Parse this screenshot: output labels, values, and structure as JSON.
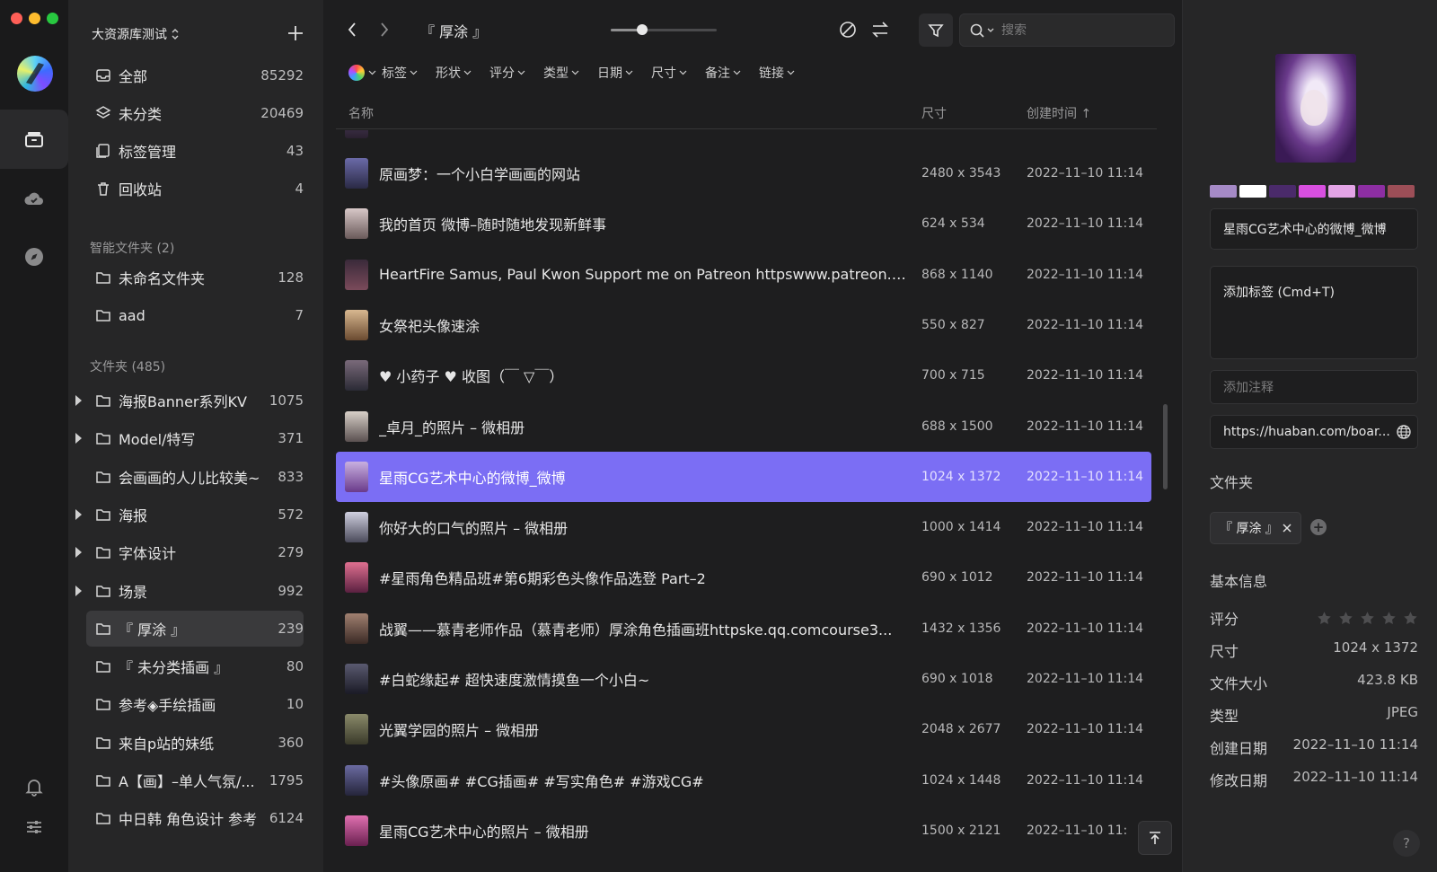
{
  "colors": {
    "accent": "#7b6ef4",
    "close": "#fe5f57",
    "minimize": "#febc2e",
    "zoom": "#28c840"
  },
  "rail": {
    "icons": [
      "app-logo",
      "library-icon",
      "cloud-icon",
      "compass-icon",
      "bell-icon",
      "sliders-icon"
    ]
  },
  "sidebar": {
    "library_name": "大资源库测试",
    "top_items": [
      {
        "icon": "inbox-icon",
        "label": "全部",
        "count": "85292"
      },
      {
        "icon": "layers-icon",
        "label": "未分类",
        "count": "20469"
      },
      {
        "icon": "tags-icon",
        "label": "标签管理",
        "count": "43"
      },
      {
        "icon": "trash-icon",
        "label": "回收站",
        "count": "4"
      }
    ],
    "smart_title": "智能文件夹 (2)",
    "smart_items": [
      {
        "label": "未命名文件夹",
        "count": "128"
      },
      {
        "label": "aad",
        "count": "7"
      }
    ],
    "folders_title": "文件夹 (485)",
    "folders": [
      {
        "label": "海报Banner系列KV",
        "count": "1075",
        "expandable": true
      },
      {
        "label": "Model/特写",
        "count": "371",
        "expandable": true
      },
      {
        "label": "会画画的人儿比较美~",
        "count": "833",
        "expandable": false
      },
      {
        "label": "海报",
        "count": "572",
        "expandable": true
      },
      {
        "label": "字体设计",
        "count": "279",
        "expandable": true
      },
      {
        "label": "场景",
        "count": "992",
        "expandable": true
      },
      {
        "label": "『 厚涂 』",
        "count": "239",
        "expandable": false,
        "selected": true
      },
      {
        "label": "『 未分类插画 』",
        "count": "80",
        "expandable": false
      },
      {
        "label": "参考◈手绘插画",
        "count": "10",
        "expandable": false
      },
      {
        "label": "来自p站的妹纸",
        "count": "360",
        "expandable": false
      },
      {
        "label": "A【画】–单人气氛/...",
        "count": "1795",
        "expandable": false
      },
      {
        "label": "中日韩 角色设计 参考",
        "count": "6124",
        "expandable": false
      }
    ]
  },
  "toolbar": {
    "breadcrumb": "『 厚涂 』",
    "zoom_level": 0.3,
    "search_placeholder": "搜索"
  },
  "filters": [
    "标签",
    "形状",
    "评分",
    "类型",
    "日期",
    "尺寸",
    "备注",
    "链接"
  ],
  "columns": {
    "name": "名称",
    "size": "尺寸",
    "created": "创建时间 ↑"
  },
  "rows": [
    {
      "name": "原画梦：一个小白学画画的网站",
      "size": "2480 x 3543",
      "date": "2022–11–10 11:14"
    },
    {
      "name": "我的首页 微博–随时随地发现新鲜事",
      "size": "624 x 534",
      "date": "2022–11–10 11:14"
    },
    {
      "name": "HeartFire Samus, Paul Kwon Support me on Patreon httpswww.patreon.c...",
      "size": "868 x 1140",
      "date": "2022–11–10 11:14"
    },
    {
      "name": "女祭祀头像速涂",
      "size": "550 x 827",
      "date": "2022–11–10 11:14"
    },
    {
      "name": "♥ 小药子 ♥ 收图（￣ ▽￣）",
      "size": "700 x 715",
      "date": "2022–11–10 11:14"
    },
    {
      "name": "_卓月_的照片 – 微相册",
      "size": "688 x 1500",
      "date": "2022–11–10 11:14"
    },
    {
      "name": "星雨CG艺术中心的微博_微博",
      "size": "1024 x 1372",
      "date": "2022–11–10 11:14",
      "selected": true
    },
    {
      "name": "你好大的口气的照片 – 微相册",
      "size": "1000 x 1414",
      "date": "2022–11–10 11:14"
    },
    {
      "name": "#星雨角色精品班#第6期彩色头像作品选登 Part–2",
      "size": "690 x 1012",
      "date": "2022–11–10 11:14"
    },
    {
      "name": "战翼——慕青老师作品（慕青老师）厚涂角色插画班httpske.qq.comcourse3...",
      "size": "1432 x 1356",
      "date": "2022–11–10 11:14"
    },
    {
      "name": "#白蛇缘起# 超快速度激情摸鱼一个小白~",
      "size": "690 x 1018",
      "date": "2022–11–10 11:14"
    },
    {
      "name": "光翼学园的照片 – 微相册",
      "size": "2048 x 2677",
      "date": "2022–11–10 11:14"
    },
    {
      "name": "#头像原画# #CG插画# #写实角色# #游戏CG#",
      "size": "1024 x 1448",
      "date": "2022–11–10 11:14"
    },
    {
      "name": "星雨CG艺术中心的照片 – 微相册",
      "size": "1500 x 2121",
      "date": "2022–11–10 11:"
    }
  ],
  "inspector": {
    "palette": [
      "#a58ac6",
      "#ffffff",
      "#4a2a6a",
      "#d84fe0",
      "#e3a4e6",
      "#8d2ea3",
      "#9c4e57"
    ],
    "title": "星雨CG艺术中心的微博_微博",
    "tags_placeholder": "添加标签 (Cmd+T)",
    "note_placeholder": "添加注释",
    "url": "https://huaban.com/boar...",
    "folder_label": "文件夹",
    "folder_chip": "『 厚涂 』",
    "basic_info_label": "基本信息",
    "rating_label": "评分",
    "rating": 0,
    "rating_max": 5,
    "size_label": "尺寸",
    "size_value": "1024 x 1372",
    "filesize_label": "文件大小",
    "filesize_value": "423.8 KB",
    "type_label": "类型",
    "type_value": "JPEG",
    "created_label": "创建日期",
    "created_value": "2022–11–10 11:14",
    "modified_label": "修改日期",
    "modified_value": "2022–11–10 11:14",
    "help_label": "?"
  }
}
